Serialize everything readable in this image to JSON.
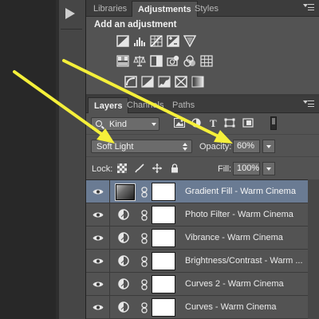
{
  "adjustments_panel": {
    "tabs": [
      {
        "label": "Libraries",
        "active": false
      },
      {
        "label": "Adjustments",
        "active": true
      },
      {
        "label": "Styles",
        "active": false
      }
    ],
    "title": "Add an adjustment",
    "icons": [
      "brightness-contrast-icon",
      "levels-icon",
      "curves-icon",
      "exposure-icon",
      "vibrance-icon",
      "hue-saturation-icon",
      "color-balance-icon",
      "black-white-icon",
      "photo-filter-icon",
      "channel-mixer-icon",
      "color-lookup-icon",
      "invert-icon",
      "posterize-icon",
      "threshold-icon",
      "selective-color-icon",
      "gradient-map-icon"
    ]
  },
  "layers_panel": {
    "tabs": [
      {
        "label": "Layers",
        "active": true
      },
      {
        "label": "Channels",
        "active": false
      },
      {
        "label": "Paths",
        "active": false
      }
    ],
    "filter": {
      "kind_label": "Kind"
    },
    "blend_mode": "Soft Light",
    "opacity_label": "Opacity:",
    "opacity_value": "60%",
    "lock_label": "Lock:",
    "fill_label": "Fill:",
    "fill_value": "100%",
    "layers": [
      {
        "name": "Gradient Fill - Warm Cinema",
        "type": "gradient",
        "selected": true
      },
      {
        "name": "Photo Filter - Warm Cinema",
        "type": "adjustment",
        "selected": false
      },
      {
        "name": "Vibrance - Warm Cinema",
        "type": "adjustment",
        "selected": false
      },
      {
        "name": "Brightness/Contrast - Warm ...",
        "type": "adjustment",
        "selected": false
      },
      {
        "name": "Curves 2 - Warm Cinema",
        "type": "adjustment",
        "selected": false
      },
      {
        "name": "Curves - Warm Cinema",
        "type": "adjustment",
        "selected": false
      }
    ]
  },
  "colors": {
    "panel_bg": "#535353",
    "selected_row": "#6a7b93",
    "annotation_arrow": "#f5f03a"
  }
}
